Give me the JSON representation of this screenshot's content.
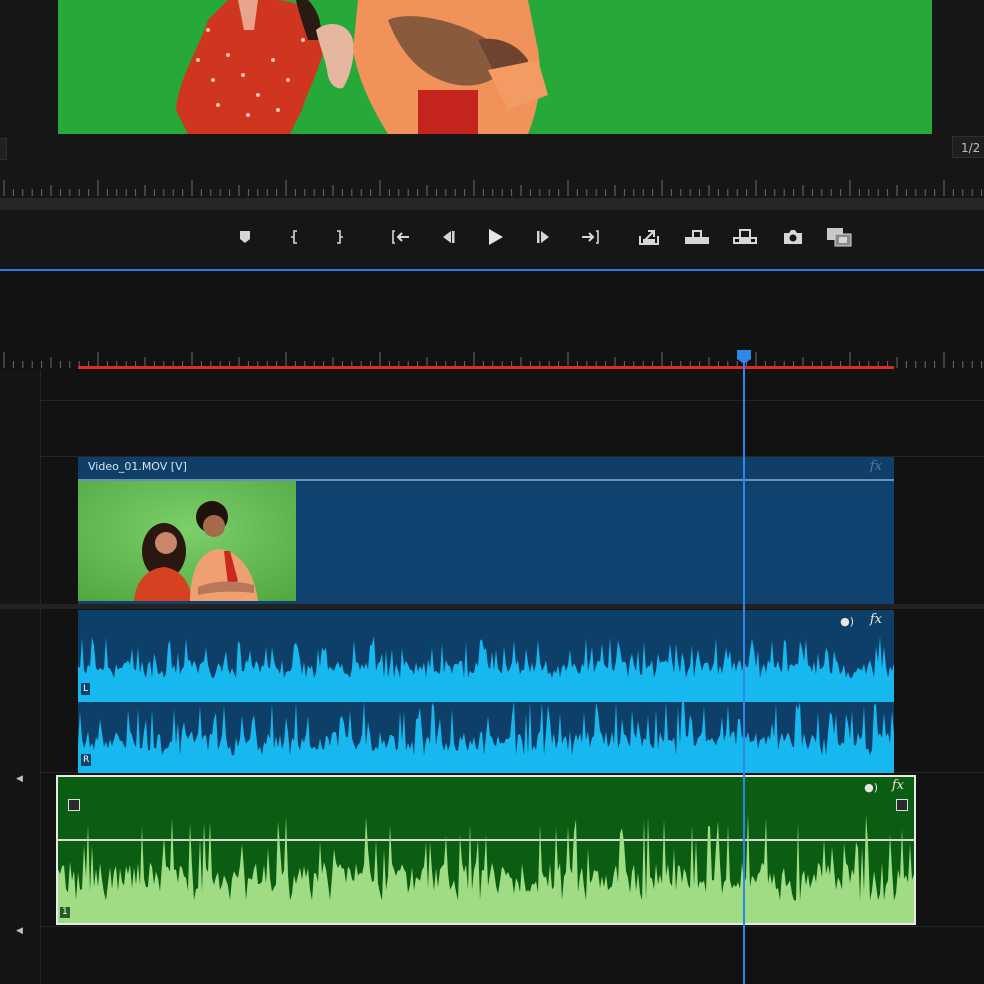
{
  "monitor": {
    "page_indicator": "1/2",
    "frame_colors": {
      "greenscreen": "#27a93a"
    }
  },
  "transport": {
    "buttons": [
      {
        "name": "add-marker-button",
        "icon": "marker-icon"
      },
      {
        "name": "mark-in-button",
        "icon": "mark-in-icon"
      },
      {
        "name": "mark-out-button",
        "icon": "mark-out-icon"
      },
      {
        "name": "go-to-in-button",
        "icon": "go-to-in-icon"
      },
      {
        "name": "step-back-button",
        "icon": "step-back-icon"
      },
      {
        "name": "play-button",
        "icon": "play-icon"
      },
      {
        "name": "step-forward-button",
        "icon": "step-forward-icon"
      },
      {
        "name": "go-to-out-button",
        "icon": "go-to-out-icon"
      },
      {
        "name": "lift-button",
        "icon": "lift-icon"
      },
      {
        "name": "insert-button",
        "icon": "insert-icon"
      },
      {
        "name": "overwrite-button",
        "icon": "overwrite-icon"
      },
      {
        "name": "export-frame-button",
        "icon": "camera-icon"
      },
      {
        "name": "comparison-view-button",
        "icon": "comparison-icon"
      }
    ]
  },
  "timeline": {
    "video_clip": {
      "name": "Video_01.MOV [V]",
      "fx": "fx"
    },
    "audio_clip": {
      "channel_left": "L",
      "channel_right": "R",
      "fx": "fx"
    },
    "audio_clip_2": {
      "channel": "1",
      "fx": "fx"
    },
    "colors": {
      "video_clip": "#0f426e",
      "audio_waveform": "#17b7f0",
      "audio2_clip": "#0b5d12",
      "audio2_waveform": "#9fdc84",
      "playhead": "#2e86e8",
      "work_area": "#e22b20"
    }
  }
}
